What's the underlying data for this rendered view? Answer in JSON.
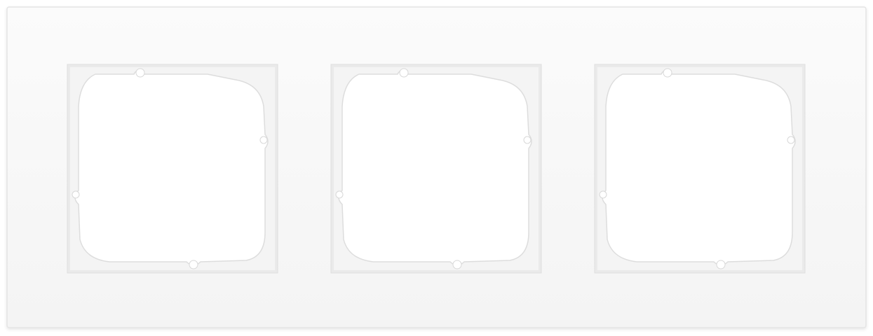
{
  "product": {
    "type": "triple switch cover frame",
    "color": "matte white",
    "gang_count": 3
  },
  "colors": {
    "background": "#ffffff",
    "frame_face": "#f8f8f8",
    "frame_edge": "#e6e6e6",
    "recess": "#eeeeee",
    "insert_ring": "#f3f3f3",
    "opening": "#ffffff"
  }
}
